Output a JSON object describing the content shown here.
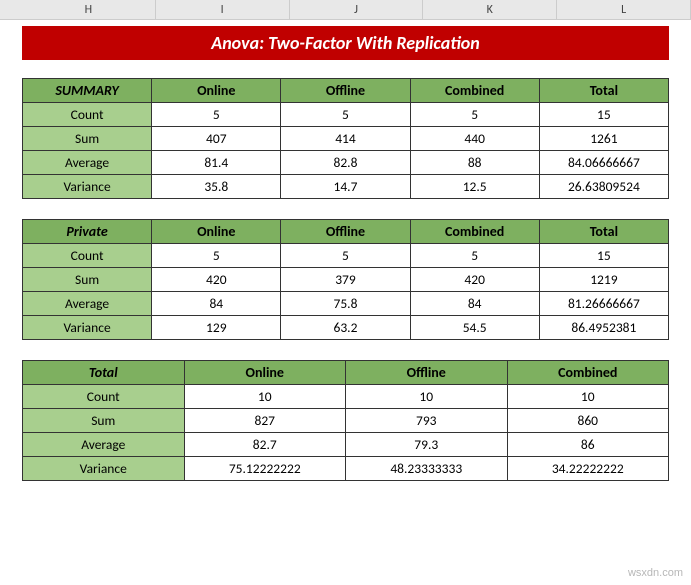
{
  "columns": [
    "H",
    "I",
    "J",
    "K",
    "L"
  ],
  "title": "Anova: Two-Factor With Replication",
  "watermark": "wsxdn.com",
  "tables": [
    {
      "showTotal": true,
      "header": [
        "SUMMARY",
        "Online",
        "Offline",
        "Combined",
        "Total"
      ],
      "rows": [
        [
          "Count",
          "5",
          "5",
          "5",
          "15"
        ],
        [
          "Sum",
          "407",
          "414",
          "440",
          "1261"
        ],
        [
          "Average",
          "81.4",
          "82.8",
          "88",
          "84.06666667"
        ],
        [
          "Variance",
          "35.8",
          "14.7",
          "12.5",
          "26.63809524"
        ]
      ]
    },
    {
      "showTotal": true,
      "header": [
        "Private",
        "Online",
        "Offline",
        "Combined",
        "Total"
      ],
      "rows": [
        [
          "Count",
          "5",
          "5",
          "5",
          "15"
        ],
        [
          "Sum",
          "420",
          "379",
          "420",
          "1219"
        ],
        [
          "Average",
          "84",
          "75.8",
          "84",
          "81.26666667"
        ],
        [
          "Variance",
          "129",
          "63.2",
          "54.5",
          "86.4952381"
        ]
      ]
    },
    {
      "showTotal": false,
      "header": [
        "Total",
        "Online",
        "Offline",
        "Combined",
        ""
      ],
      "rows": [
        [
          "Count",
          "10",
          "10",
          "10",
          ""
        ],
        [
          "Sum",
          "827",
          "793",
          "860",
          ""
        ],
        [
          "Average",
          "82.7",
          "79.3",
          "86",
          ""
        ],
        [
          "Variance",
          "75.12222222",
          "48.23333333",
          "34.22222222",
          ""
        ]
      ]
    }
  ],
  "chart_data": [
    {
      "type": "table",
      "title": "SUMMARY",
      "categories": [
        "Online",
        "Offline",
        "Combined",
        "Total"
      ],
      "series": [
        {
          "name": "Count",
          "values": [
            5,
            5,
            5,
            15
          ]
        },
        {
          "name": "Sum",
          "values": [
            407,
            414,
            440,
            1261
          ]
        },
        {
          "name": "Average",
          "values": [
            81.4,
            82.8,
            88,
            84.06666667
          ]
        },
        {
          "name": "Variance",
          "values": [
            35.8,
            14.7,
            12.5,
            26.63809524
          ]
        }
      ]
    },
    {
      "type": "table",
      "title": "Private",
      "categories": [
        "Online",
        "Offline",
        "Combined",
        "Total"
      ],
      "series": [
        {
          "name": "Count",
          "values": [
            5,
            5,
            5,
            15
          ]
        },
        {
          "name": "Sum",
          "values": [
            420,
            379,
            420,
            1219
          ]
        },
        {
          "name": "Average",
          "values": [
            84,
            75.8,
            84,
            81.26666667
          ]
        },
        {
          "name": "Variance",
          "values": [
            129,
            63.2,
            54.5,
            86.4952381
          ]
        }
      ]
    },
    {
      "type": "table",
      "title": "Total",
      "categories": [
        "Online",
        "Offline",
        "Combined"
      ],
      "series": [
        {
          "name": "Count",
          "values": [
            10,
            10,
            10
          ]
        },
        {
          "name": "Sum",
          "values": [
            827,
            793,
            860
          ]
        },
        {
          "name": "Average",
          "values": [
            82.7,
            79.3,
            86
          ]
        },
        {
          "name": "Variance",
          "values": [
            75.12222222,
            48.23333333,
            34.22222222
          ]
        }
      ]
    }
  ]
}
